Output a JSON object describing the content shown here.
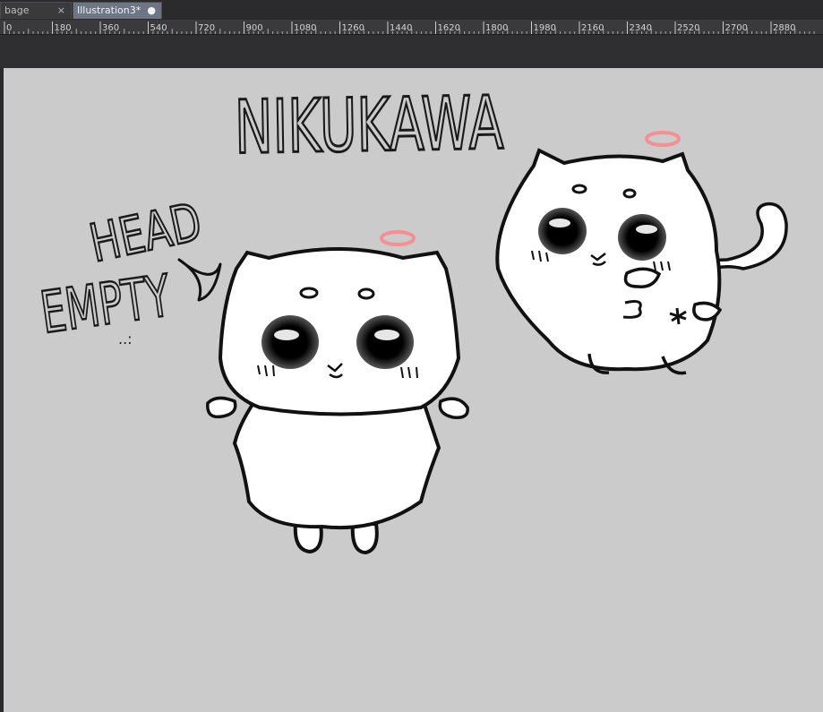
{
  "tabs": [
    {
      "label": "bage",
      "close_icon": "×",
      "active": false
    },
    {
      "label": "Illustration3*",
      "modified_icon": "●",
      "active": true
    }
  ],
  "ruler": {
    "labels": [
      "0",
      "180",
      "360",
      "540",
      "720",
      "900",
      "1080",
      "1260",
      "1440",
      "1620",
      "1800",
      "1980",
      "2160",
      "2340",
      "2520",
      "2700",
      "2880"
    ]
  },
  "artwork": {
    "title_text": "NIKUKAWA",
    "caption_line1": "HEAD",
    "caption_line2": "EMPTY",
    "caption_dots": "..:",
    "halo_color": "#ff7f85",
    "paper_color": "#cbcbcb"
  },
  "colors": {
    "tab_active": "#6e7686",
    "tab_inactive": "#3a3a3d",
    "ruler_bg": "#3a3a3c",
    "workspace_bg": "#2f2f31"
  }
}
